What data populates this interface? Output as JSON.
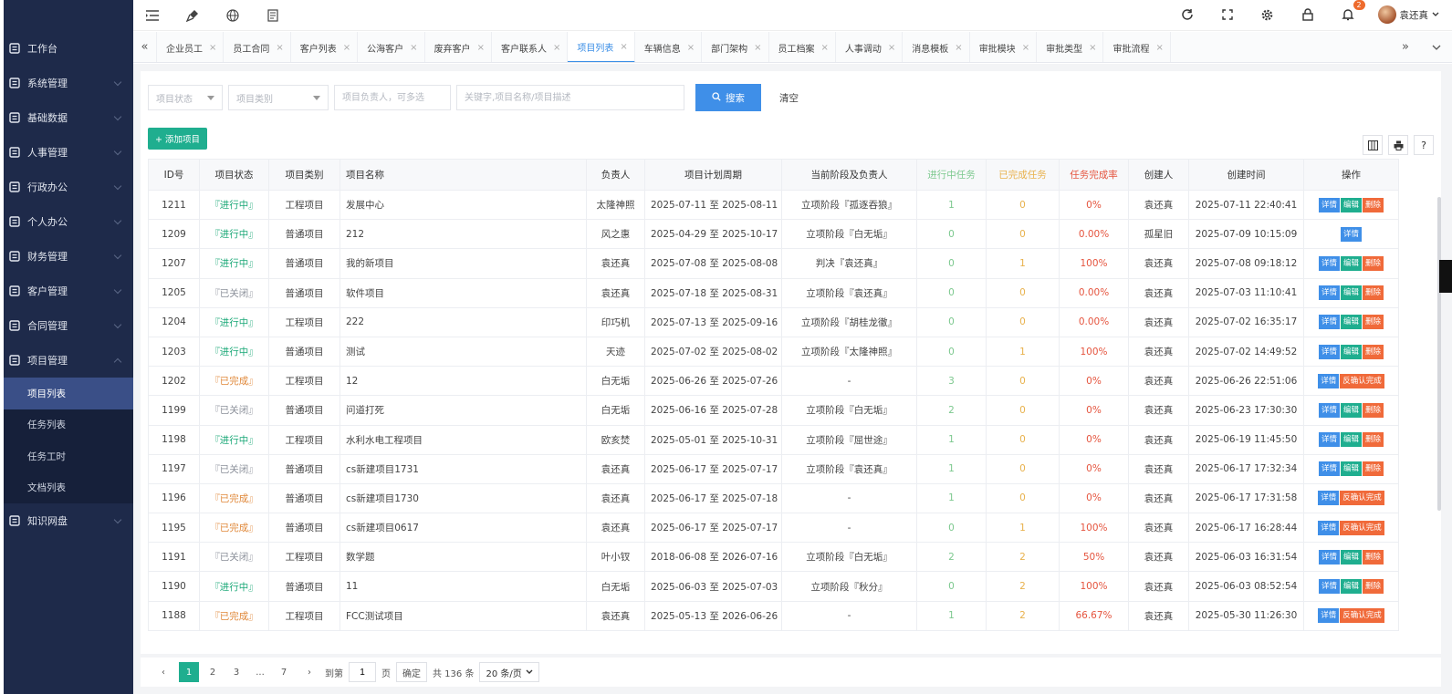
{
  "sidebar": {
    "items": [
      {
        "label": "工作台",
        "icon": "dashboard-icon",
        "arrow": false
      },
      {
        "label": "系统管理",
        "icon": "settings-icon",
        "arrow": true
      },
      {
        "label": "基础数据",
        "icon": "data-icon",
        "arrow": true
      },
      {
        "label": "人事管理",
        "icon": "person-icon",
        "arrow": true
      },
      {
        "label": "行政办公",
        "icon": "office-icon",
        "arrow": true
      },
      {
        "label": "个人办公",
        "icon": "personal-icon",
        "arrow": true
      },
      {
        "label": "财务管理",
        "icon": "finance-icon",
        "arrow": true
      },
      {
        "label": "客户管理",
        "icon": "customer-icon",
        "arrow": true
      },
      {
        "label": "合同管理",
        "icon": "contract-icon",
        "arrow": true
      },
      {
        "label": "项目管理",
        "icon": "project-icon",
        "arrow": true,
        "open": true
      }
    ],
    "sub_items": [
      {
        "label": "项目列表",
        "active": true
      },
      {
        "label": "任务列表"
      },
      {
        "label": "任务工时"
      },
      {
        "label": "文档列表"
      }
    ],
    "last_item": {
      "label": "知识网盘",
      "icon": "disk-icon"
    }
  },
  "topbar": {
    "notification_count": "2",
    "user_name": "袁还真"
  },
  "tabs": [
    {
      "label": "企业员工"
    },
    {
      "label": "员工合同"
    },
    {
      "label": "客户列表"
    },
    {
      "label": "公海客户"
    },
    {
      "label": "废弃客户"
    },
    {
      "label": "客户联系人"
    },
    {
      "label": "项目列表",
      "active": true
    },
    {
      "label": "车辆信息"
    },
    {
      "label": "部门架构"
    },
    {
      "label": "员工档案"
    },
    {
      "label": "人事调动"
    },
    {
      "label": "消息模板"
    },
    {
      "label": "审批模块"
    },
    {
      "label": "审批类型"
    },
    {
      "label": "审批流程"
    }
  ],
  "filters": {
    "status_placeholder": "项目状态",
    "type_placeholder": "项目类别",
    "owner_placeholder": "项目负责人，可多选",
    "keyword_placeholder": "关键字,项目名称/项目描述",
    "search_label": "搜索",
    "clear_label": "清空"
  },
  "add_button": "+ 添加项目",
  "table": {
    "headers": [
      "ID号",
      "项目状态",
      "项目类别",
      "项目名称",
      "负责人",
      "项目计划周期",
      "当前阶段及负责人",
      "进行中任务",
      "已完成任务",
      "任务完成率",
      "创建人",
      "创建时间",
      "操作"
    ],
    "rows": [
      {
        "id": "1211",
        "status": "『进行中』",
        "s": "run",
        "type": "工程项目",
        "name": "发展中心",
        "owner": "太隆神照",
        "period": "2025-07-11 至 2025-08-11",
        "stage": "立项阶段『孤逐吞狼』",
        "doing": "1",
        "done": "0",
        "rate": "0%",
        "creator": "袁还真",
        "time": "2025-07-11 22:40:41",
        "ops": [
          "详情",
          "编辑",
          "删除"
        ]
      },
      {
        "id": "1209",
        "status": "『进行中』",
        "s": "run",
        "type": "普通项目",
        "name": "212",
        "owner": "风之惠",
        "period": "2025-04-29 至 2025-10-17",
        "stage": "立项阶段『白无垢』",
        "doing": "0",
        "done": "0",
        "rate": "0.00%",
        "creator": "孤星旧",
        "time": "2025-07-09 10:15:09",
        "ops": [
          "详情"
        ]
      },
      {
        "id": "1207",
        "status": "『进行中』",
        "s": "run",
        "type": "普通项目",
        "name": "我的新项目",
        "owner": "袁还真",
        "period": "2025-07-08 至 2025-08-08",
        "stage": "判决『袁还真』",
        "doing": "0",
        "done": "1",
        "rate": "100%",
        "creator": "袁还真",
        "time": "2025-07-08 09:18:12",
        "ops": [
          "详情",
          "编辑",
          "删除"
        ]
      },
      {
        "id": "1205",
        "status": "『已关闭』",
        "s": "closed",
        "type": "普通项目",
        "name": "软件项目",
        "owner": "袁还真",
        "period": "2025-07-18 至 2025-08-31",
        "stage": "立项阶段『袁还真』",
        "doing": "0",
        "done": "0",
        "rate": "0.00%",
        "creator": "袁还真",
        "time": "2025-07-03 11:10:41",
        "ops": [
          "详情",
          "编辑",
          "删除"
        ]
      },
      {
        "id": "1204",
        "status": "『进行中』",
        "s": "run",
        "type": "工程项目",
        "name": "222",
        "owner": "印巧机",
        "period": "2025-07-13 至 2025-09-16",
        "stage": "立项阶段『胡桂龙徹』",
        "doing": "0",
        "done": "0",
        "rate": "0.00%",
        "creator": "袁还真",
        "time": "2025-07-02 16:35:17",
        "ops": [
          "详情",
          "编辑",
          "删除"
        ]
      },
      {
        "id": "1203",
        "status": "『进行中』",
        "s": "run",
        "type": "普通项目",
        "name": "测试",
        "owner": "天迹",
        "period": "2025-07-02 至 2025-08-02",
        "stage": "立项阶段『太隆神照』",
        "doing": "0",
        "done": "1",
        "rate": "100%",
        "creator": "袁还真",
        "time": "2025-07-02 14:49:52",
        "ops": [
          "详情",
          "编辑",
          "删除"
        ]
      },
      {
        "id": "1202",
        "status": "『已完成』",
        "s": "done",
        "type": "工程项目",
        "name": "12",
        "owner": "白无垢",
        "period": "2025-06-26 至 2025-07-26",
        "stage": "-",
        "doing": "3",
        "done": "0",
        "rate": "0%",
        "creator": "袁还真",
        "time": "2025-06-26 22:51:06",
        "ops": [
          "详情",
          "反确认完成"
        ]
      },
      {
        "id": "1199",
        "status": "『已关闭』",
        "s": "closed",
        "type": "普通项目",
        "name": "问道打死",
        "owner": "白无垢",
        "period": "2025-06-16 至 2025-07-28",
        "stage": "立项阶段『白无垢』",
        "doing": "2",
        "done": "0",
        "rate": "0%",
        "creator": "袁还真",
        "time": "2025-06-23 17:30:30",
        "ops": [
          "详情",
          "编辑",
          "删除"
        ]
      },
      {
        "id": "1198",
        "status": "『进行中』",
        "s": "run",
        "type": "工程项目",
        "name": "水利水电工程项目",
        "owner": "欧亥焚",
        "period": "2025-05-01 至 2025-10-31",
        "stage": "立项阶段『屈世途』",
        "doing": "1",
        "done": "0",
        "rate": "0%",
        "creator": "袁还真",
        "time": "2025-06-19 11:45:50",
        "ops": [
          "详情",
          "编辑",
          "删除"
        ]
      },
      {
        "id": "1197",
        "status": "『已关闭』",
        "s": "closed",
        "type": "普通项目",
        "name": "cs新建项目1731",
        "owner": "袁还真",
        "period": "2025-06-17 至 2025-07-17",
        "stage": "立项阶段『袁还真』",
        "doing": "1",
        "done": "0",
        "rate": "0%",
        "creator": "袁还真",
        "time": "2025-06-17 17:32:34",
        "ops": [
          "详情",
          "编辑",
          "删除"
        ]
      },
      {
        "id": "1196",
        "status": "『已完成』",
        "s": "done",
        "type": "普通项目",
        "name": "cs新建项目1730",
        "owner": "袁还真",
        "period": "2025-06-17 至 2025-07-18",
        "stage": "-",
        "doing": "1",
        "done": "0",
        "rate": "0%",
        "creator": "袁还真",
        "time": "2025-06-17 17:31:58",
        "ops": [
          "详情",
          "反确认完成"
        ]
      },
      {
        "id": "1195",
        "status": "『已完成』",
        "s": "done",
        "type": "普通项目",
        "name": "cs新建项目0617",
        "owner": "袁还真",
        "period": "2025-06-17 至 2025-07-17",
        "stage": "-",
        "doing": "0",
        "done": "1",
        "rate": "100%",
        "creator": "袁还真",
        "time": "2025-06-17 16:28:44",
        "ops": [
          "详情",
          "反确认完成"
        ]
      },
      {
        "id": "1191",
        "status": "『已关闭』",
        "s": "closed",
        "type": "工程项目",
        "name": "数学题",
        "owner": "叶小钗",
        "period": "2018-06-08 至 2026-07-16",
        "stage": "立项阶段『白无垢』",
        "doing": "2",
        "done": "2",
        "rate": "50%",
        "creator": "袁还真",
        "time": "2025-06-03 16:31:54",
        "ops": [
          "详情",
          "编辑",
          "删除"
        ]
      },
      {
        "id": "1190",
        "status": "『进行中』",
        "s": "run",
        "type": "普通项目",
        "name": "11",
        "owner": "白无垢",
        "period": "2025-06-03 至 2025-07-03",
        "stage": "立项阶段『秋分』",
        "doing": "0",
        "done": "2",
        "rate": "100%",
        "creator": "袁还真",
        "time": "2025-06-03 08:52:54",
        "ops": [
          "详情",
          "编辑",
          "删除"
        ]
      },
      {
        "id": "1188",
        "status": "『已完成』",
        "s": "done",
        "type": "工程项目",
        "name": "FCC测试项目",
        "owner": "袁还真",
        "period": "2025-05-13 至 2026-06-26",
        "stage": "-",
        "doing": "1",
        "done": "2",
        "rate": "66.67%",
        "creator": "袁还真",
        "time": "2025-05-30 11:26:30",
        "ops": [
          "详情",
          "反确认完成"
        ]
      }
    ]
  },
  "pager": {
    "pages": [
      "1",
      "2",
      "3",
      "...",
      "7"
    ],
    "goto_label": "到第",
    "goto_value": "1",
    "page_unit": "页",
    "confirm_label": "确定",
    "total_label": "共 136 条",
    "size_label": "20 条/页"
  }
}
